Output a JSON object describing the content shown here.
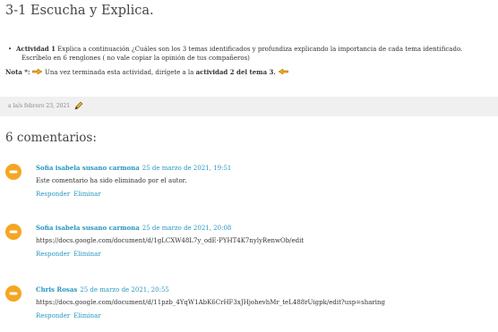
{
  "post": {
    "title": "3-1 Escucha y Explica.",
    "bullet": "•",
    "activity_label": "Actividad 1",
    "activity_text_1": " Explica a continuación ¿Cuáles son los 3 temas identificados y profundiza explicando la importancia de cada tema identificado.",
    "activity_text_2": "Escríbelo en 6 renglones ( no vale copiar la opinión  de tus compañeros)",
    "nota_label": "Nota *:",
    "nota_text_1": " Una vez terminada esta actividad, dirígete a  la ",
    "nota_bold": "actividad 2 del tema 3.",
    "footer_date": "a la/s febrero 23, 2021"
  },
  "comments_section": {
    "title": "6 comentarios:",
    "comments": [
      {
        "author": "Sofia isabela susano carmona",
        "date": "25 de marzo de 2021, 19:51",
        "body": "Este comentario ha sido eliminado por el autor.",
        "reply": "Responder",
        "delete": "Eliminar"
      },
      {
        "author": "Sofia isabela susano carmona",
        "date": "25 de marzo de 2021, 20:08",
        "body": "https://docs.google.com/document/d/1gLCXW48L7y_odE-PYHT4K7nylyRenwOb/edit",
        "reply": "Responder",
        "delete": "Eliminar"
      },
      {
        "author": "Chris Rosas",
        "date": "25 de marzo de 2021, 20:55",
        "body": "https://docs.google.com/document/d/11pzb_4YqW1AbK6CrHF3xJHjohevhMr_teL488rUigpk/edit?usp=sharing",
        "reply": "Responder",
        "delete": "Eliminar"
      }
    ]
  },
  "colors": {
    "accent": "#2596be",
    "avatar": "#f5a623",
    "footer_bg": "#f0f0f0"
  }
}
